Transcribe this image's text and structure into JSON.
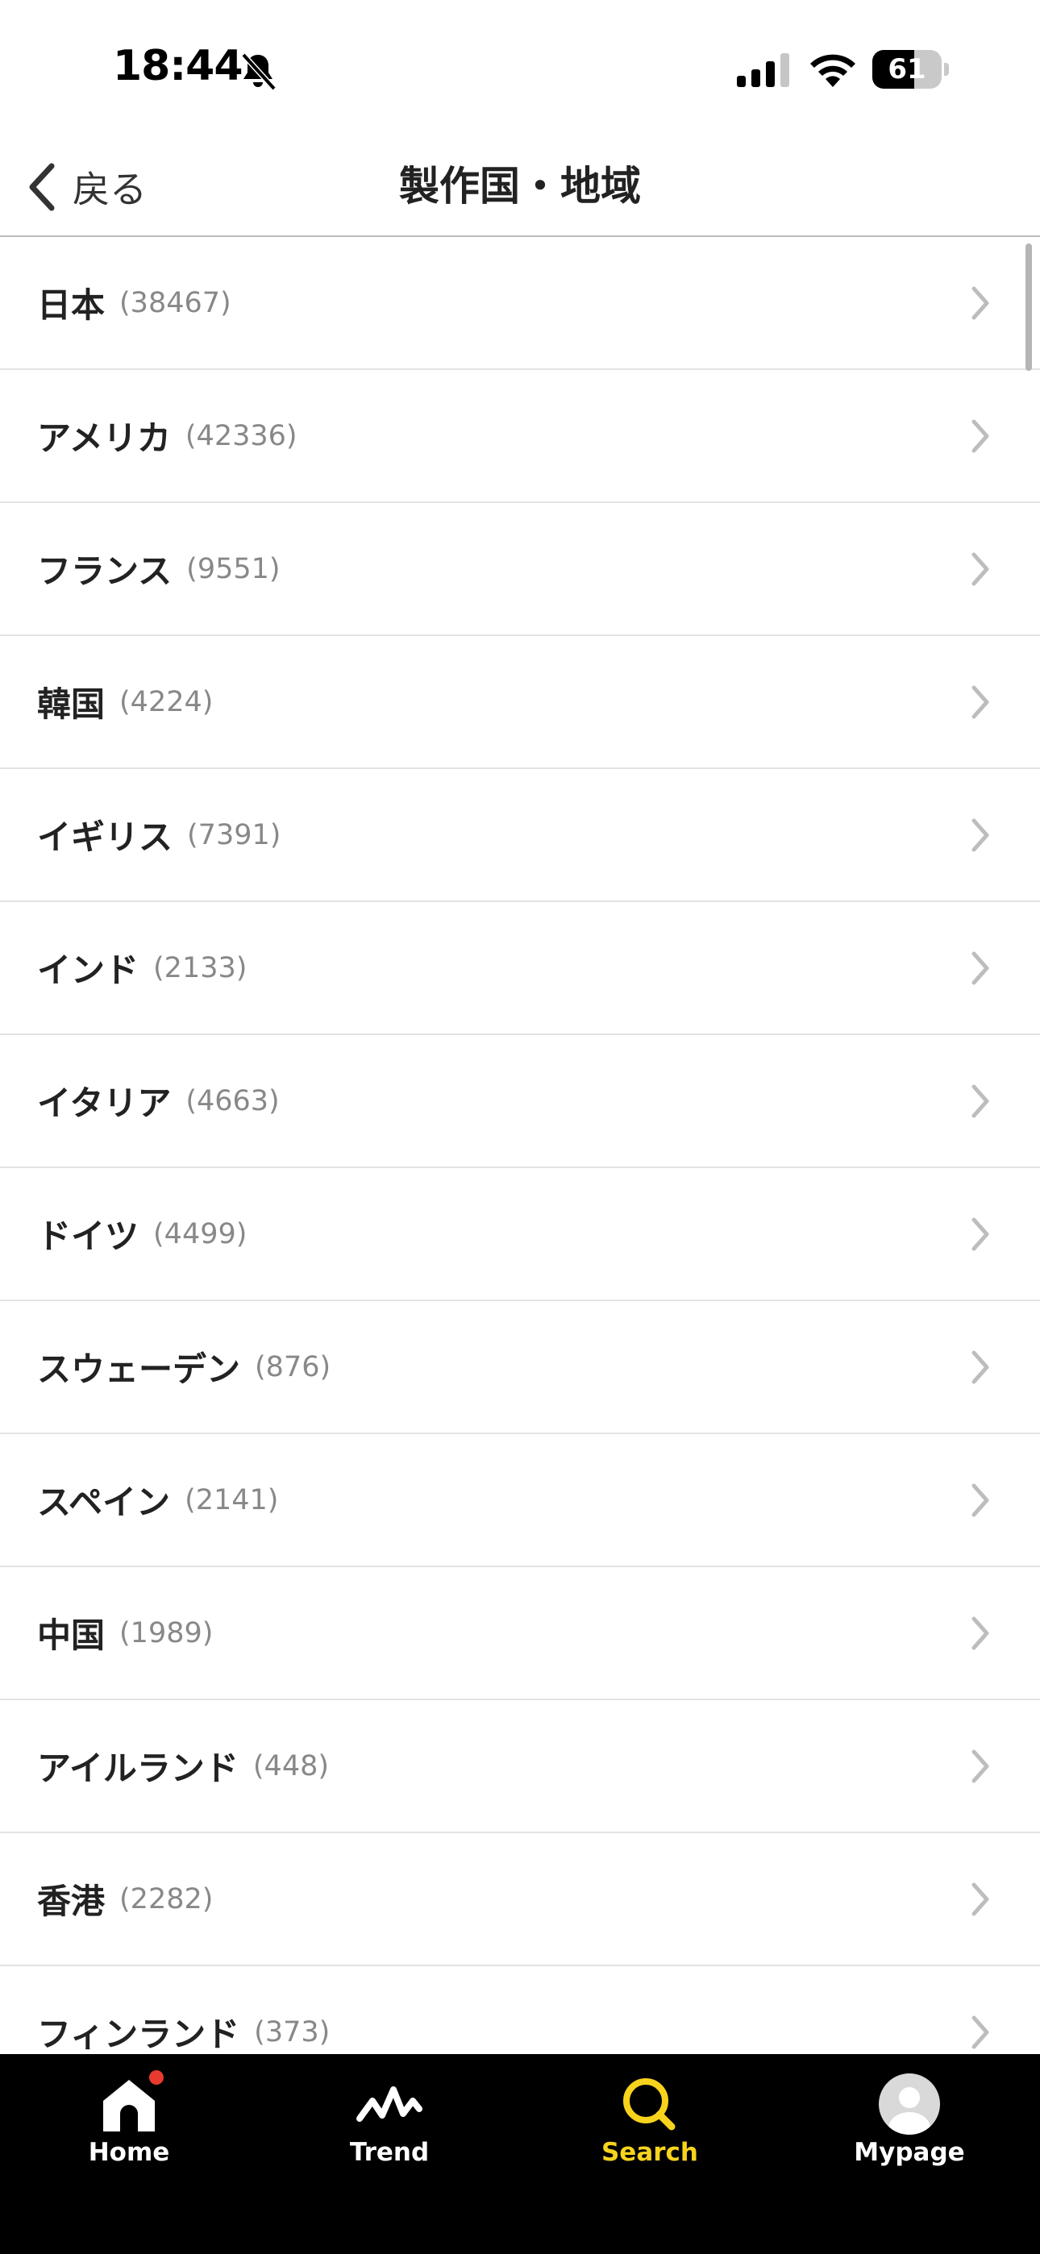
{
  "status_bar": {
    "time": "18:44",
    "battery_level": "61",
    "battery_percent": 61,
    "icons": [
      "bell-slash-icon",
      "signal-icon",
      "wifi-icon",
      "battery-icon"
    ]
  },
  "nav": {
    "back_label": "戻る",
    "title": "製作国・地域"
  },
  "list": {
    "items": [
      {
        "name": "日本",
        "count": "(38467)"
      },
      {
        "name": "アメリカ",
        "count": "(42336)"
      },
      {
        "name": "フランス",
        "count": "(9551)"
      },
      {
        "name": "韓国",
        "count": "(4224)"
      },
      {
        "name": "イギリス",
        "count": "(7391)"
      },
      {
        "name": "インド",
        "count": "(2133)"
      },
      {
        "name": "イタリア",
        "count": "(4663)"
      },
      {
        "name": "ドイツ",
        "count": "(4499)"
      },
      {
        "name": "スウェーデン",
        "count": "(876)"
      },
      {
        "name": "スペイン",
        "count": "(2141)"
      },
      {
        "name": "中国",
        "count": "(1989)"
      },
      {
        "name": "アイルランド",
        "count": "(448)"
      },
      {
        "name": "香港",
        "count": "(2282)"
      },
      {
        "name": "フィンランド",
        "count": "(373)"
      }
    ]
  },
  "tab_bar": {
    "tabs": [
      {
        "label": "Home",
        "icon": "home-icon",
        "has_badge": true
      },
      {
        "label": "Trend",
        "icon": "trend-icon"
      },
      {
        "label": "Search",
        "icon": "search-icon",
        "active": true
      },
      {
        "label": "Mypage",
        "icon": "avatar-icon"
      }
    ],
    "active_color": "#f7d31d",
    "badge_color": "#e63b2e"
  }
}
